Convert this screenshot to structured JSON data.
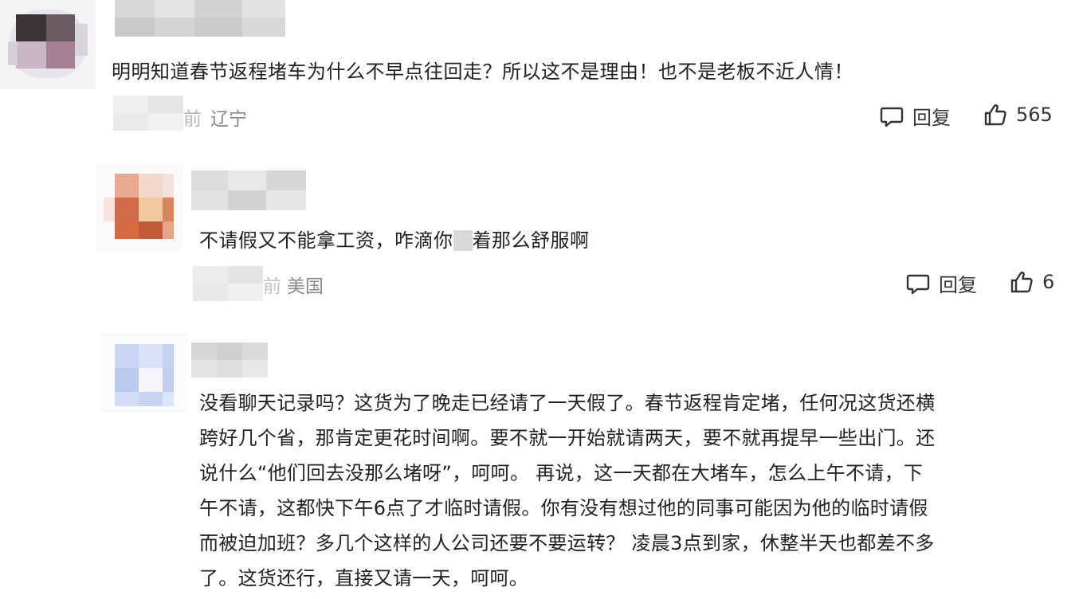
{
  "comments": [
    {
      "text": "明明知道春节返程堵车为什么不早点往回走？所以这不是理由！也不是老板不近人情！",
      "meta_suffix": "前",
      "location": "辽宁",
      "reply_label": "回复",
      "likes": "565"
    },
    {
      "text": "不请假又不能拿工资，咋滴你",
      "text_after_blur": "着那么舒服啊",
      "meta_suffix": "前",
      "location": "美国",
      "reply_label": "回复",
      "likes": "6"
    },
    {
      "lines": [
        "没看聊天记录吗？这货为了晚走已经请了一天假了。春节返程肯定堵，任何况这货还横",
        "跨好几个省，那肯定更花时间啊。要不就一开始就请两天，要不就再提早一些出门。还",
        "说什么“他们回去没那么堵呀”，呵呵。 再说，这一天都在大堵车，怎么上午不请，下",
        "午不请，这都快下午6点了才临时请假。你有没有想过他的同事可能因为他的临时请假",
        "而被迫加班？多几个这样的人公司还要不要运转？ 凌晨3点到家，休整半天也都差不多",
        "了。这货还行，直接又请一天，呵呵。"
      ]
    }
  ],
  "icons": {
    "reply": "comment-bubble-icon",
    "like": "thumbs-up-icon"
  }
}
